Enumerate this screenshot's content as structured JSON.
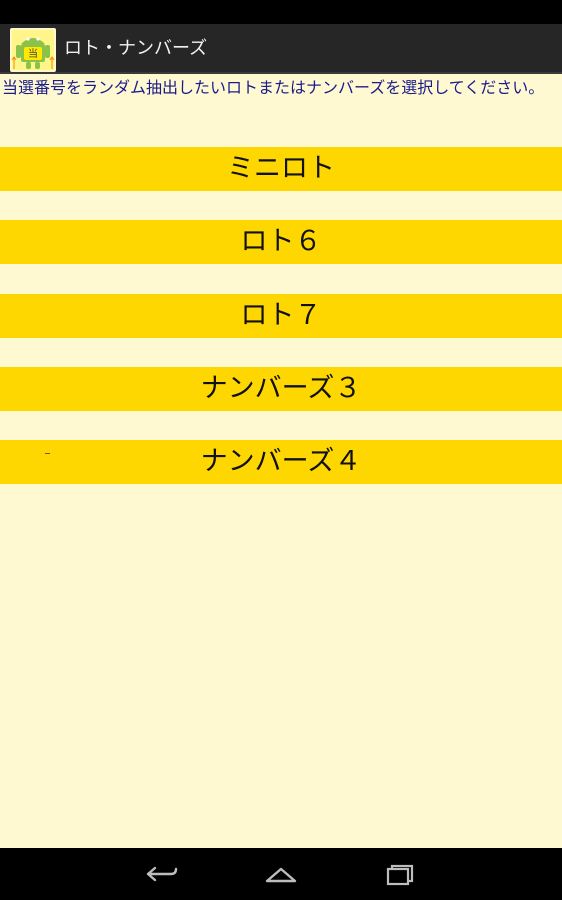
{
  "app": {
    "title": "ロト・ナンバーズ"
  },
  "content": {
    "instruction": "当選番号をランダム抽出したいロトまたはナンバーズを選択してください。",
    "buttons": [
      "ミニロト",
      "ロト６",
      "ロト７",
      "ナンバーズ３",
      "ナンバーズ４"
    ]
  },
  "icons": {
    "app": "android-lottery-icon",
    "back": "back-icon",
    "home": "home-icon",
    "recent": "recent-apps-icon"
  },
  "colors": {
    "background": "#fff9d1",
    "button": "#ffd700",
    "action_bar": "#262626",
    "text_blue": "#1b1b8a"
  }
}
